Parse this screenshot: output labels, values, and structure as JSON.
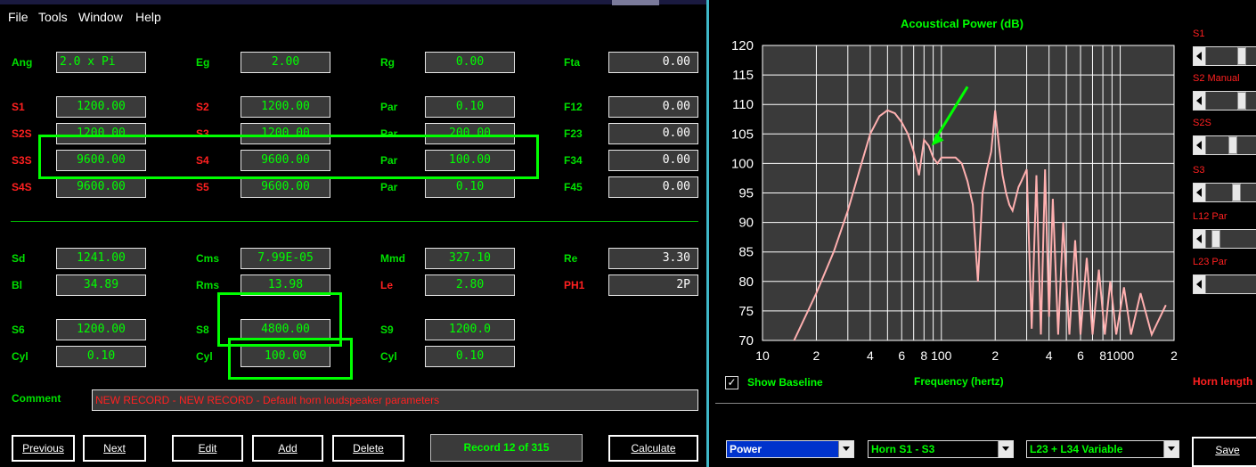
{
  "menu": [
    "File",
    "Tools",
    "Window",
    "Help"
  ],
  "params": {
    "row0": [
      {
        "label": "Ang",
        "value": "2.0 x Pi"
      },
      {
        "label": "Eg",
        "value": "2.00"
      },
      {
        "label": "Rg",
        "value": "0.00"
      },
      {
        "label": "Fta",
        "value": "0.00"
      }
    ],
    "row1": [
      {
        "label": "S1",
        "value": "1200.00"
      },
      {
        "label": "S2",
        "value": "1200.00"
      },
      {
        "label": "Par",
        "value": "0.10"
      },
      {
        "label": "F12",
        "value": "0.00"
      }
    ],
    "row2": [
      {
        "label": "S2S",
        "value": "1200.00"
      },
      {
        "label": "S3",
        "value": "1200.00"
      },
      {
        "label": "Par",
        "value": "200.00"
      },
      {
        "label": "F23",
        "value": "0.00"
      }
    ],
    "row3": [
      {
        "label": "S3S",
        "value": "9600.00"
      },
      {
        "label": "S4",
        "value": "9600.00"
      },
      {
        "label": "Par",
        "value": "100.00"
      },
      {
        "label": "F34",
        "value": "0.00"
      }
    ],
    "row4": [
      {
        "label": "S4S",
        "value": "9600.00"
      },
      {
        "label": "S5",
        "value": "9600.00"
      },
      {
        "label": "Par",
        "value": "0.10"
      },
      {
        "label": "F45",
        "value": "0.00"
      }
    ],
    "row5": [
      {
        "label": "Sd",
        "value": "1241.00"
      },
      {
        "label": "Cms",
        "value": "7.99E-05"
      },
      {
        "label": "Mmd",
        "value": "327.10"
      },
      {
        "label": "Re",
        "value": "3.30"
      }
    ],
    "row6": [
      {
        "label": "Bl",
        "value": "34.89"
      },
      {
        "label": "Rms",
        "value": "13.98"
      },
      {
        "label": "Le",
        "value": "2.80"
      },
      {
        "label": "PH1",
        "value": "2P"
      }
    ],
    "row7": [
      {
        "label": "S6",
        "value": "1200.00"
      },
      {
        "label": "S8",
        "value": "4800.00"
      },
      {
        "label": "S9",
        "value": "1200.0"
      }
    ],
    "row8": [
      {
        "label": "Cyl",
        "value": "0.10"
      },
      {
        "label": "Cyl",
        "value": "100.00"
      },
      {
        "label": "Cyl",
        "value": "0.10"
      }
    ]
  },
  "comment": {
    "label": "Comment",
    "value": "NEW RECORD - NEW RECORD - Default horn loudspeaker parameters"
  },
  "buttons": {
    "previous": "Previous",
    "next": "Next",
    "edit": "Edit",
    "add": "Add",
    "delete": "Delete",
    "calculate": "Calculate"
  },
  "record_status": "Record 12 of 315",
  "chart_data": {
    "type": "line",
    "title": "Acoustical Power (dB)",
    "xlabel": "Frequency (hertz)",
    "ylabel": "",
    "x_scale": "log",
    "xlim": [
      10,
      2000
    ],
    "ylim": [
      70,
      120
    ],
    "x_ticks": [
      "10",
      "2",
      "4",
      "6",
      "8",
      "100",
      "2",
      "4",
      "6",
      "8",
      "1000",
      "2"
    ],
    "y_ticks": [
      "120",
      "115",
      "110",
      "105",
      "100",
      "95",
      "90",
      "85",
      "80",
      "75",
      "70"
    ],
    "grid": true,
    "line_color": "#ffb0b0",
    "series": [
      {
        "values_x": [
          15,
          20,
          25,
          30,
          35,
          40,
          45,
          50,
          55,
          60,
          65,
          70,
          75,
          80,
          85,
          90,
          95,
          100,
          110,
          120,
          130,
          140,
          150,
          160,
          170,
          180,
          190,
          200,
          210,
          220,
          230,
          240,
          250,
          260,
          270,
          280,
          290,
          300
        ],
        "values_y": [
          70,
          78,
          85,
          92,
          99,
          105,
          108,
          109,
          108.5,
          107,
          105,
          102,
          98,
          104,
          103,
          101,
          100,
          101,
          101,
          101,
          100,
          97,
          93,
          80,
          95,
          99,
          102,
          109,
          103,
          98,
          95,
          93,
          92,
          94,
          96,
          97,
          98,
          99
        ]
      }
    ]
  },
  "right_panel": {
    "sliders": [
      {
        "label": "S1",
        "level": 0.62
      },
      {
        "label": "S2 Manual",
        "level": 0.62
      },
      {
        "label": "S2S",
        "level": 0.45
      },
      {
        "label": "S3",
        "level": 0.52
      },
      {
        "label": "L12 Par",
        "level": 0.1
      },
      {
        "label": "L23 Par",
        "level": 0.0
      }
    ],
    "show_baseline": "Show Baseline",
    "horn_length": "Horn length",
    "selects": [
      "Power",
      "Horn S1 - S3",
      "L23 + L34 Variable"
    ],
    "save": "Save"
  },
  "colors": {
    "accent": "#00ff00",
    "label_red": "#ff2020",
    "curve": "#ffb0b0",
    "grid_bg": "#3a3a3a"
  }
}
